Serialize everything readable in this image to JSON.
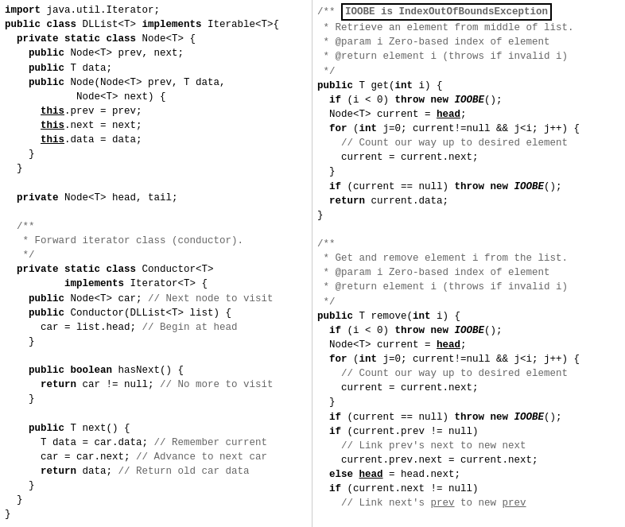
{
  "left": {
    "lines": [
      "import java.util.Iterator;",
      "public class DLList<T> implements Iterable<T>{",
      "  private static class Node<T> {",
      "    public Node<T> prev, next;",
      "    public T data;",
      "    public Node(Node<T> prev, T data,",
      "                Node<T> next) {",
      "      this.prev = prev;",
      "      this.next = next;",
      "      this.data = data;",
      "    }",
      "  }",
      "",
      "  private Node<T> head, tail;",
      "",
      "  /**",
      "   * Forward iterator class (conductor).",
      "   */",
      "  private static class Conductor<T>",
      "          implements Iterator<T> {",
      "    public Node<T> car; // Next node to visit",
      "    public Conductor(DLList<T> list) {",
      "      car = list.head; // Begin at head",
      "    }",
      "",
      "    public boolean hasNext() {",
      "      return car != null; // No more to visit",
      "    }",
      "",
      "    public T next() {",
      "      T data = car.data; // Remember current",
      "      car = car.next; // Advance to next car",
      "      return data; // Return old car data",
      "    }",
      "  }",
      "}"
    ]
  },
  "right": {
    "annotation": "IOOBE is IndexOutOfBoundsException",
    "lines": [
      "/**",
      " * Retrieve an element from middle of list.",
      " * @param i Zero-based index of element",
      " * @return element i (throws if invalid i)",
      " */",
      "public T get(int i) {",
      "  if (i < 0) throw new IOOBE();",
      "  Node<T> current = head;",
      "  for (int j=0; current!=null && j<i; j++) {",
      "    // Count our way up to desired element",
      "    current = current.next;",
      "  }",
      "  if (current == null) throw new IOOBE();",
      "  return current.data;",
      "}",
      "",
      "/**",
      " * Get and remove element i from the list.",
      " * @param i Zero-based index of element",
      " * @return element i (throws if invalid i)",
      " */",
      "public T remove(int i) {",
      "  if (i < 0) throw new IOOBE();",
      "  Node<T> current = head;",
      "  for (int j=0; current!=null && j<i; j++) {",
      "    // Count our way up to desired element",
      "    current = current.next;",
      "  }",
      "  if (current == null) throw new IOOBE();",
      "  if (current.prev != null)",
      "    // Link prev's next to new next",
      "    current.prev.next = current.next;",
      "  else head = head.next;",
      "  if (current.next != null)",
      "    // Link next's prev to new prev"
    ]
  }
}
